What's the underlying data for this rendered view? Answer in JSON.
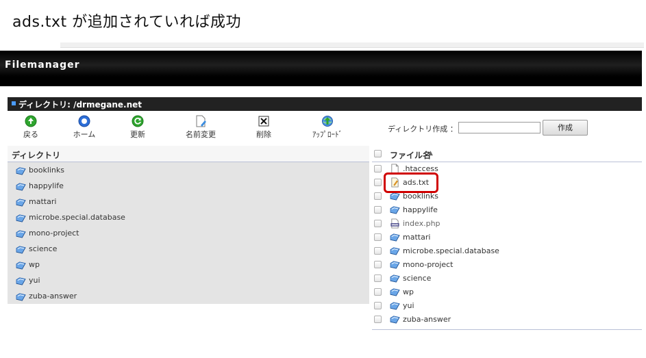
{
  "caption": "ads.txt が追加されていれば成功",
  "app": {
    "title": "Filemanager"
  },
  "directory_bar": "ディレクトリ: /drmegane.net",
  "toolbar": [
    {
      "label": "戻る",
      "icon": "back-icon"
    },
    {
      "label": "ホーム",
      "icon": "home-icon"
    },
    {
      "label": "更新",
      "icon": "refresh-icon"
    },
    {
      "label": "名前変更",
      "icon": "rename-icon"
    },
    {
      "label": "削除",
      "icon": "delete-icon"
    },
    {
      "label": "ｱｯﾌﾟﾛｰﾄﾞ",
      "icon": "upload-icon"
    }
  ],
  "mkdir": {
    "label": "ディレクトリ作成 ：",
    "value": "",
    "button": "作成"
  },
  "left": {
    "header": "ディレクトリ",
    "items": [
      "booklinks",
      "happylife",
      "mattari",
      "microbe.special.database",
      "mono-project",
      "science",
      "wp",
      "yui",
      "zuba-answer"
    ]
  },
  "right": {
    "header": "ファイル名",
    "sort_indicator": "▲",
    "items": [
      {
        "name": ".htaccess",
        "type": "file"
      },
      {
        "name": "ads.txt",
        "type": "text"
      },
      {
        "name": "booklinks",
        "type": "folder"
      },
      {
        "name": "happylife",
        "type": "folder"
      },
      {
        "name": "index.php",
        "type": "php"
      },
      {
        "name": "mattari",
        "type": "folder"
      },
      {
        "name": "microbe.special.database",
        "type": "folder"
      },
      {
        "name": "mono-project",
        "type": "folder"
      },
      {
        "name": "science",
        "type": "folder"
      },
      {
        "name": "wp",
        "type": "folder"
      },
      {
        "name": "yui",
        "type": "folder"
      },
      {
        "name": "zuba-answer",
        "type": "folder"
      }
    ]
  },
  "colors": {
    "highlight": "#d00000",
    "header_bg": "#000000",
    "accent_blue": "#4a9bff"
  }
}
